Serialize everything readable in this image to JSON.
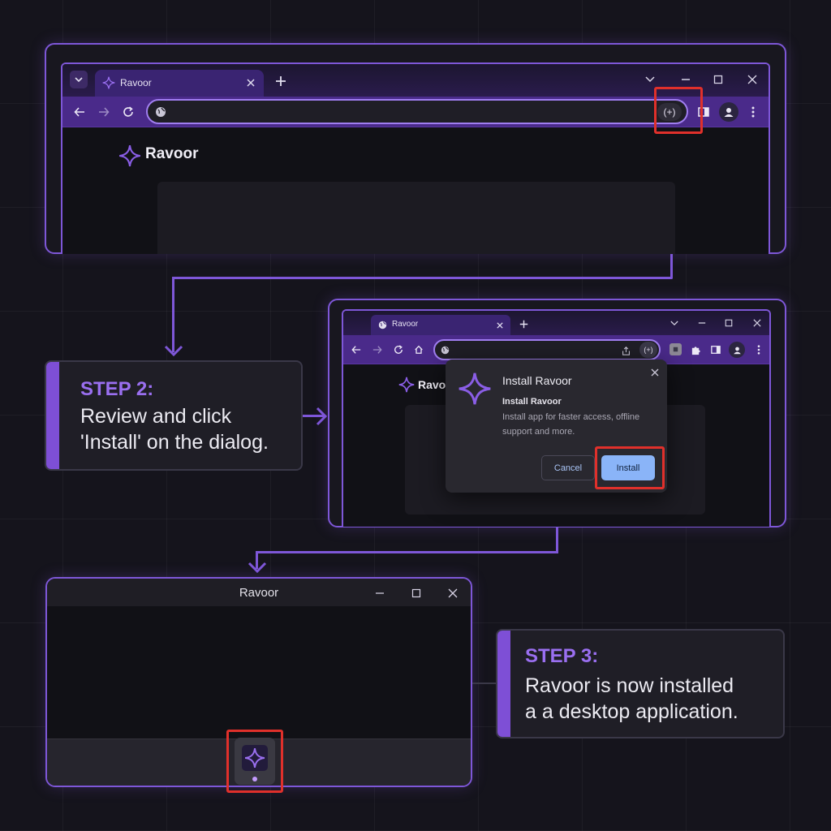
{
  "step1": {
    "tab_title": "Ravoor",
    "install_icon": "(+)",
    "brand_name": "Ravoor",
    "icons": [
      "chevron-down-icon",
      "ravoor-logo-icon",
      "close-icon",
      "plus-icon",
      "minimize-icon",
      "maximize-icon",
      "back-icon",
      "forward-icon",
      "reload-icon",
      "globe-icon",
      "install-icon",
      "sidebar-icon",
      "profile-icon",
      "more-icon"
    ]
  },
  "step2": {
    "title": "STEP 2:",
    "body_line1": "Review and click",
    "body_line2": "'Install' on the dialog.",
    "browser": {
      "tab_title": "Ravoor",
      "install_icon": "(+)",
      "brand_name": "Ravoor"
    },
    "dialog": {
      "title": "Install Ravoor",
      "subtitle": "Install Ravoor",
      "description_line1": "Install app for faster access, offline",
      "description_line2": "support and more.",
      "cancel_label": "Cancel",
      "install_label": "Install"
    }
  },
  "step3": {
    "title": "STEP 3:",
    "body_line1": "Ravoor is now installed",
    "body_line2": "a a desktop application.",
    "window_title": "Ravoor"
  },
  "colors": {
    "accent": "#7e57d8",
    "step_title": "#9a6ff0",
    "highlight": "#e0302b",
    "install_button": "#8ab4f8",
    "background": "#15141c"
  }
}
